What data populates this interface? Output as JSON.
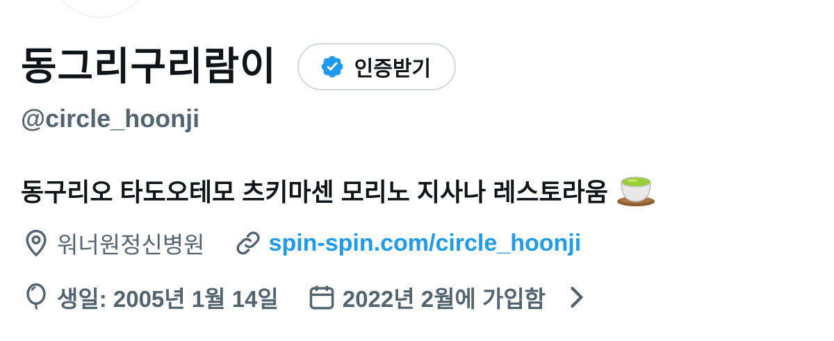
{
  "profile": {
    "display_name": "동그리구리람이",
    "verify_label": "인증받기",
    "handle": "@circle_hoonji",
    "bio": "동구리오 타도오테모 츠키마센 모리노 지사나 레스토라움",
    "location": "워너원정신병원",
    "website": "spin-spin.com/circle_hoonji",
    "birthday": "생일: 2005년 1월 14일",
    "joined": "2022년 2월에 가입함"
  },
  "colors": {
    "accent": "#1d9bf0",
    "secondary_text": "#536471",
    "primary_text": "#0f1419",
    "border": "#cfd9de"
  },
  "icons": {
    "verify": "verified-badge-icon",
    "bio_emoji": "tea-cup-emoji",
    "location": "location-pin-icon",
    "website": "link-icon",
    "birthday": "balloon-icon",
    "joined": "calendar-icon",
    "more": "chevron-right-icon"
  }
}
